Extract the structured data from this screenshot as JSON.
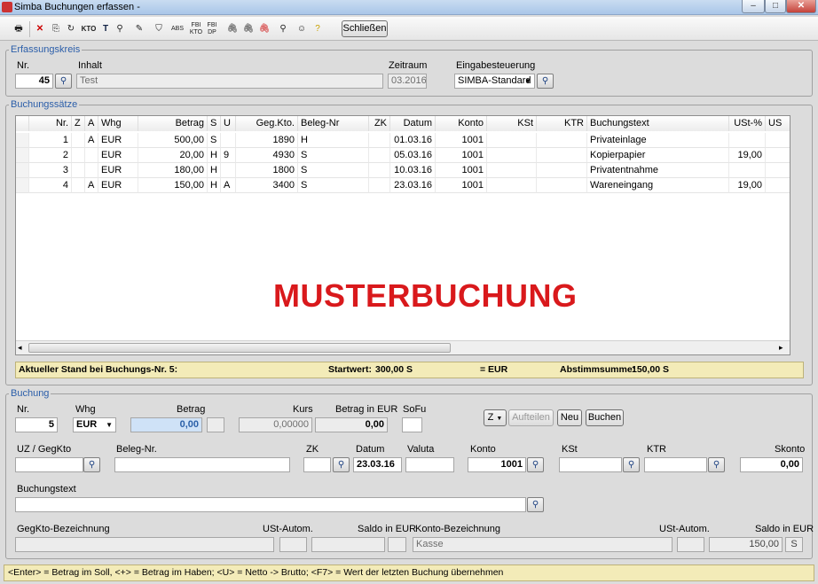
{
  "window": {
    "title": "Simba Buchungen erfassen -"
  },
  "toolbar": {
    "icons": [
      "printer-icon",
      "delete-icon",
      "copy-icon",
      "recalc-icon",
      "kto-icon",
      "text-icon",
      "search-icon",
      "sort-icon",
      "tag-icon",
      "abs-icon",
      "fb-kto-icon",
      "fb-dp-icon",
      "clip-icon",
      "clip2-icon",
      "clip-red-icon",
      "find-h-icon",
      "user-icon",
      "help-icon"
    ],
    "kto_label": "KTO",
    "text_label": "T",
    "close_label": "Schließen"
  },
  "erfassungskreis": {
    "legend": "Erfassungskreis",
    "nr_label": "Nr.",
    "nr_value": "45",
    "inhalt_label": "Inhalt",
    "inhalt_value": "Test",
    "zeitraum_label": "Zeitraum",
    "zeitraum_value": "03.2016",
    "eingabe_label": "Eingabesteuerung",
    "eingabe_value": "SIMBA-Standard"
  },
  "buchungssaetze": {
    "legend": "Buchungssätze",
    "columns": [
      "Nr.",
      "Z",
      "A",
      "Whg",
      "Betrag",
      "S",
      "U",
      "Geg.Kto.",
      "Beleg-Nr",
      "ZK",
      "Datum",
      "Konto",
      "KSt",
      "KTR",
      "Buchungstext",
      "USt-%",
      "US"
    ],
    "rows": [
      [
        "1",
        "",
        "A",
        "EUR",
        "500,00",
        "S",
        "",
        "1890",
        "H",
        "",
        "01.03.16",
        "1001",
        "",
        "",
        "Privateinlage",
        "",
        ""
      ],
      [
        "2",
        "",
        "",
        "EUR",
        "20,00",
        "H",
        "9",
        "4930",
        "S",
        "",
        "05.03.16",
        "1001",
        "",
        "",
        "Kopierpapier",
        "19,00",
        ""
      ],
      [
        "3",
        "",
        "",
        "EUR",
        "180,00",
        "H",
        "",
        "1800",
        "S",
        "",
        "10.03.16",
        "1001",
        "",
        "",
        "Privatentnahme",
        "",
        ""
      ],
      [
        "4",
        "",
        "A",
        "EUR",
        "150,00",
        "H",
        "A",
        "3400",
        "S",
        "",
        "23.03.16",
        "1001",
        "",
        "",
        "Wareneingang",
        "19,00",
        ""
      ]
    ],
    "watermark": "MUSTERBUCHUNG",
    "status": {
      "stand": "Aktueller Stand bei Buchungs-Nr. 5:",
      "startwert_label": "Startwert:",
      "startwert_value": "300,00 S",
      "eur": "= EUR",
      "abstimm_label": "Abstimmsumme:",
      "abstimm_value": "150,00 S"
    }
  },
  "buchung": {
    "legend": "Buchung",
    "nr_label": "Nr.",
    "nr_value": "5",
    "whg_label": "Whg",
    "whg_value": "EUR",
    "betrag_label": "Betrag",
    "betrag_value": "0,00",
    "kurs_label": "Kurs",
    "kurs_value": "0,00000",
    "betrag_eur_label": "Betrag in EUR",
    "betrag_eur_value": "0,00",
    "sofu_label": "SoFu",
    "z_label": "Z",
    "aufteilen_label": "Aufteilen",
    "neu_label": "Neu",
    "buchen_label": "Buchen",
    "uz_label": "UZ / GegKto",
    "beleg_label": "Beleg-Nr.",
    "zk_label": "ZK",
    "datum_label": "Datum",
    "datum_value": "23.03.16",
    "valuta_label": "Valuta",
    "konto_label": "Konto",
    "konto_value": "1001",
    "kst_label": "KSt",
    "ktr_label": "KTR",
    "skonto_label": "Skonto",
    "skonto_value": "0,00",
    "buchungstext_label": "Buchungstext",
    "gegkto_bez_label": "GegKto-Bezeichnung",
    "ust_autom_label": "USt-Autom.",
    "saldo_label": "Saldo in EUR",
    "konto_bez_label": "Konto-Bezeichnung",
    "konto_bez_value": "Kasse",
    "ust_autom2_label": "USt-Autom.",
    "saldo2_label": "Saldo in EUR",
    "saldo2_value": "150,00",
    "saldo2_side": "S"
  },
  "hint": "<Enter> = Betrag im Soll, <+> = Betrag im Haben; <U> = Netto -> Brutto; <F7> = Wert der letzten Buchung übernehmen"
}
